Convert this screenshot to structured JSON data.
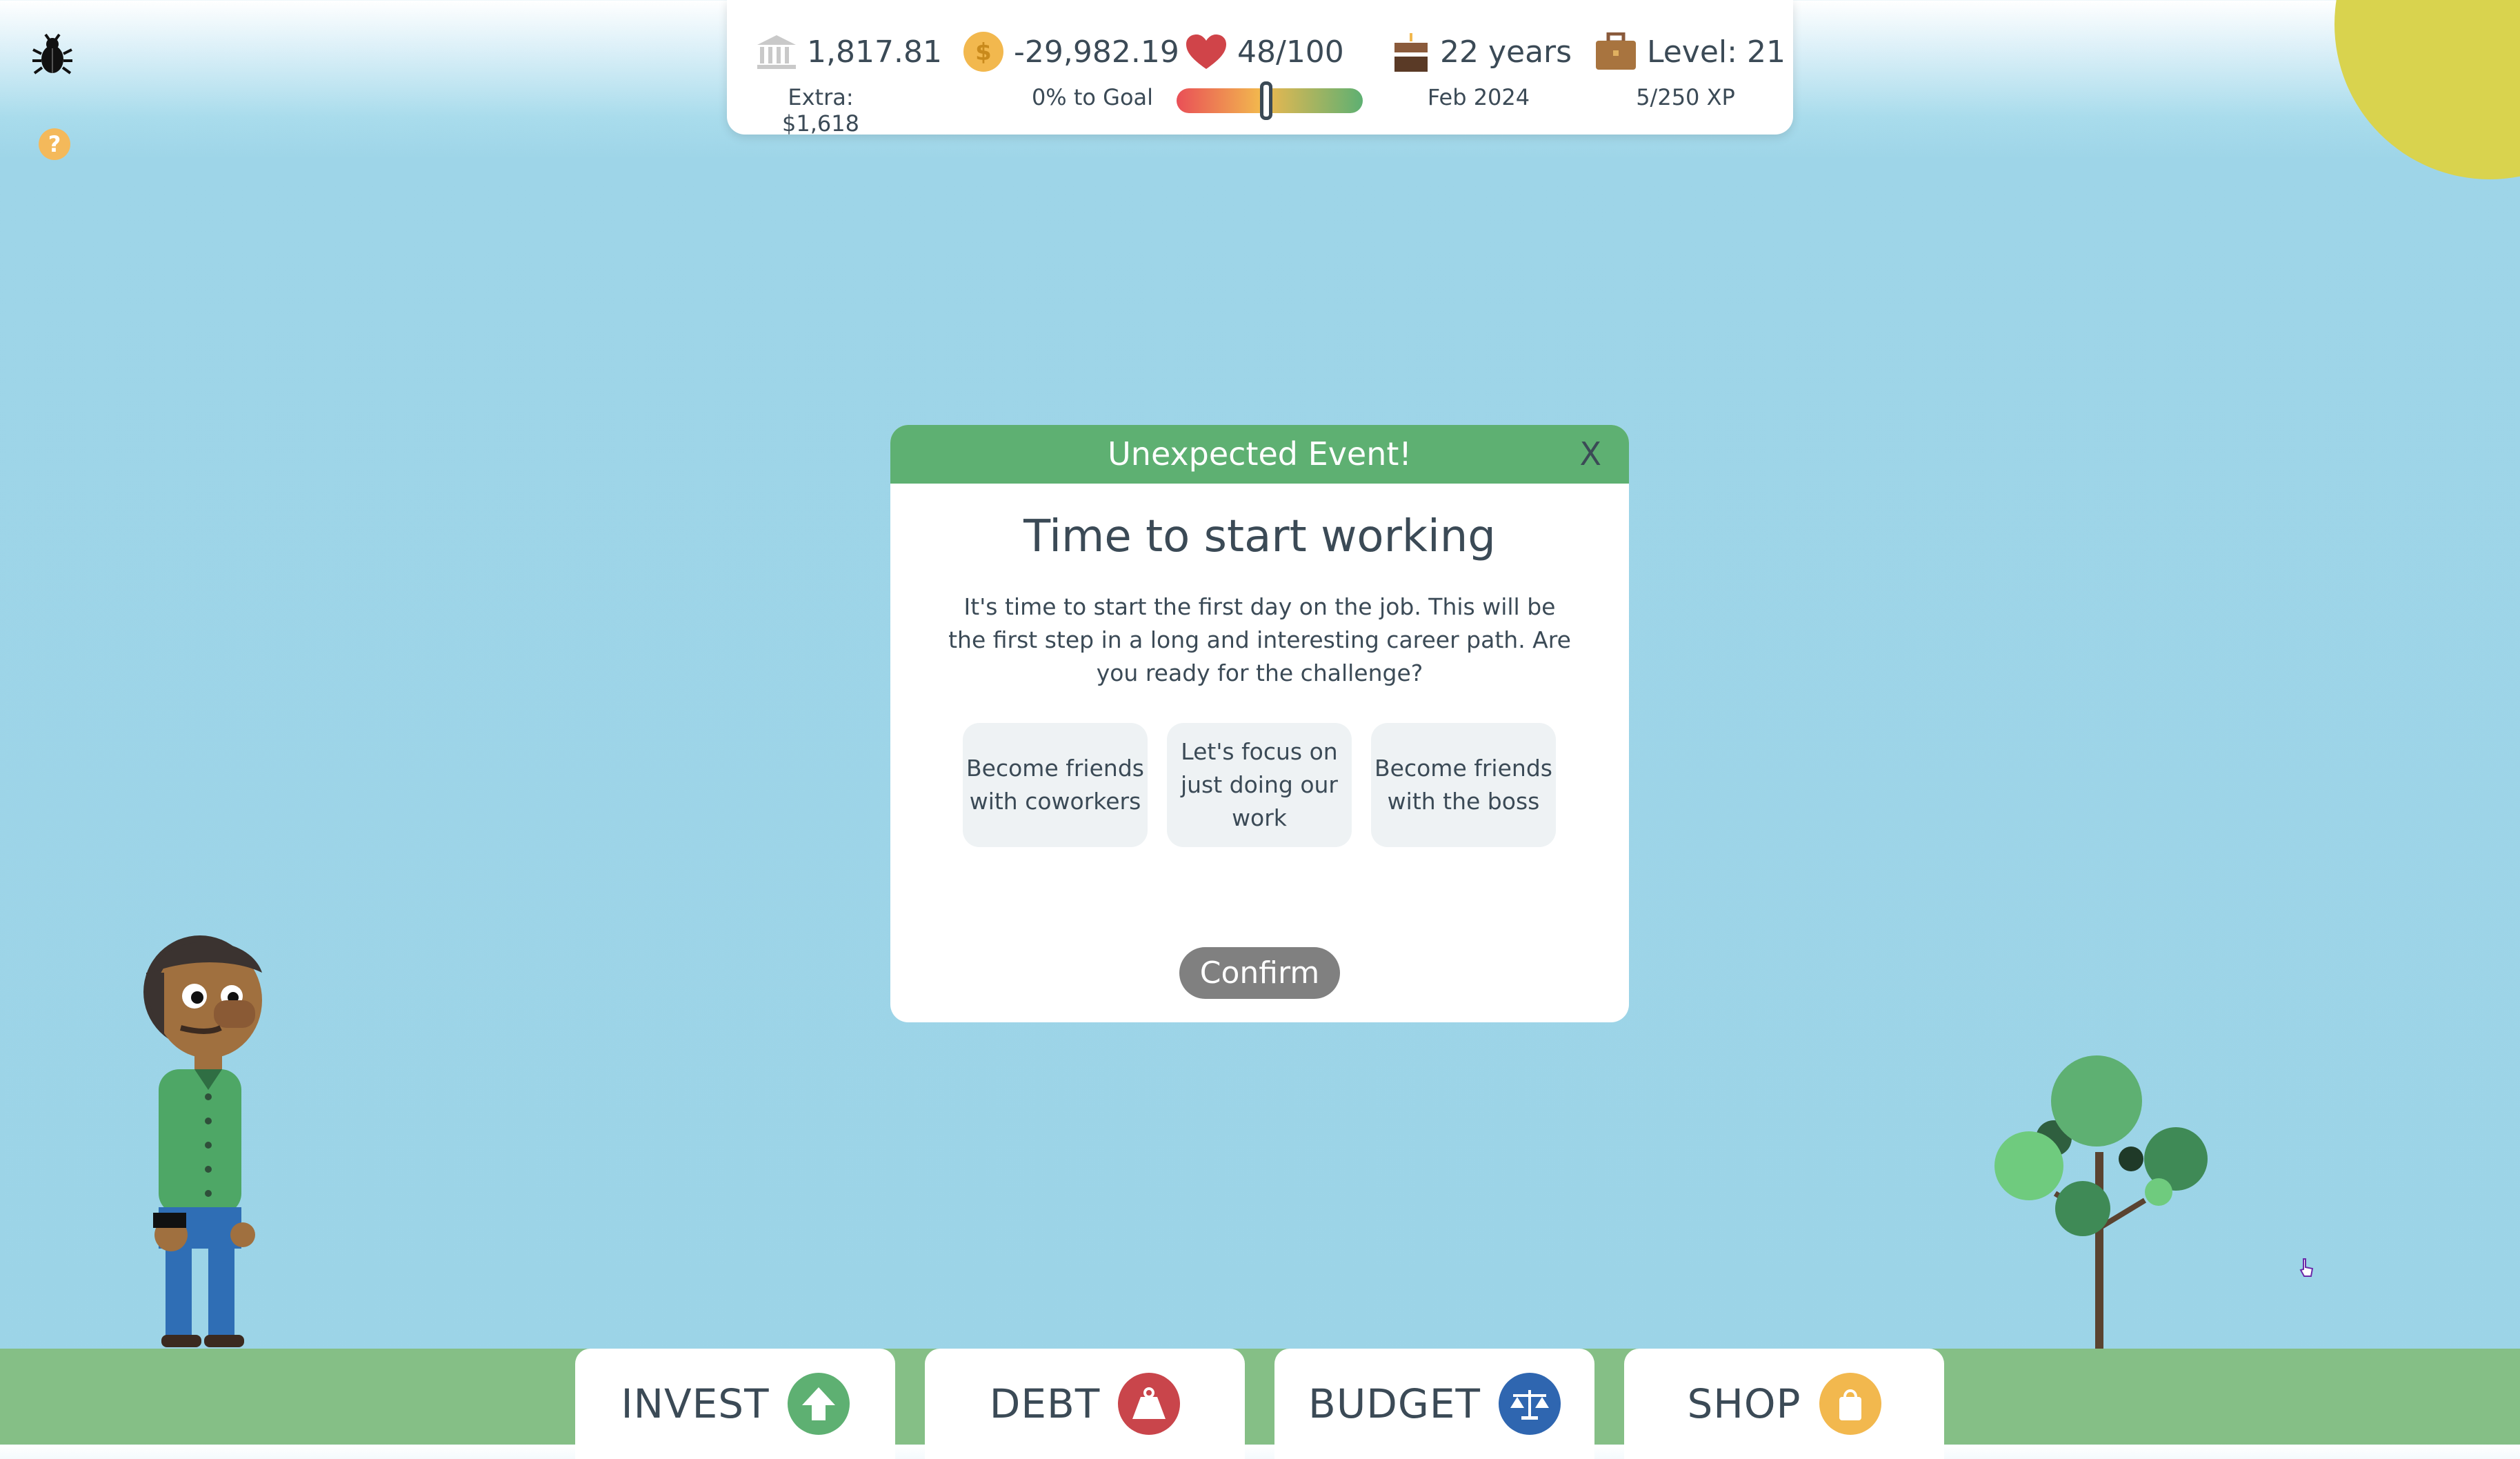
{
  "stats": {
    "bank": {
      "value": "1,817.81",
      "sub": "Extra: $1,618"
    },
    "money": {
      "value": "-29,982.19",
      "sub": "0% to Goal"
    },
    "health": {
      "value": "48/100",
      "level": 0.48
    },
    "age": {
      "value": "22 years",
      "sub": "Feb 2024"
    },
    "career": {
      "value": "Level: 21",
      "sub": "5/250 XP"
    }
  },
  "help_label": "?",
  "modal": {
    "header": "Unexpected Event!",
    "close": "X",
    "title": "Time to start working",
    "body": "It's time to start the first day on the job. This will be the first step in a long and interesting career path. Are you ready for the challenge?",
    "options": [
      "Become friends with coworkers",
      "Let's focus on just doing our work",
      "Become friends with the boss"
    ],
    "confirm": "Confirm"
  },
  "nav": [
    {
      "label": "INVEST",
      "icon": "arrow-up-icon",
      "color": "#5eb072"
    },
    {
      "label": "DEBT",
      "icon": "weight-icon",
      "color": "#c9454b"
    },
    {
      "label": "BUDGET",
      "icon": "scale-icon",
      "color": "#2f66b0"
    },
    {
      "label": "SHOP",
      "icon": "shopping-bag-icon",
      "color": "#f2b84e"
    }
  ]
}
